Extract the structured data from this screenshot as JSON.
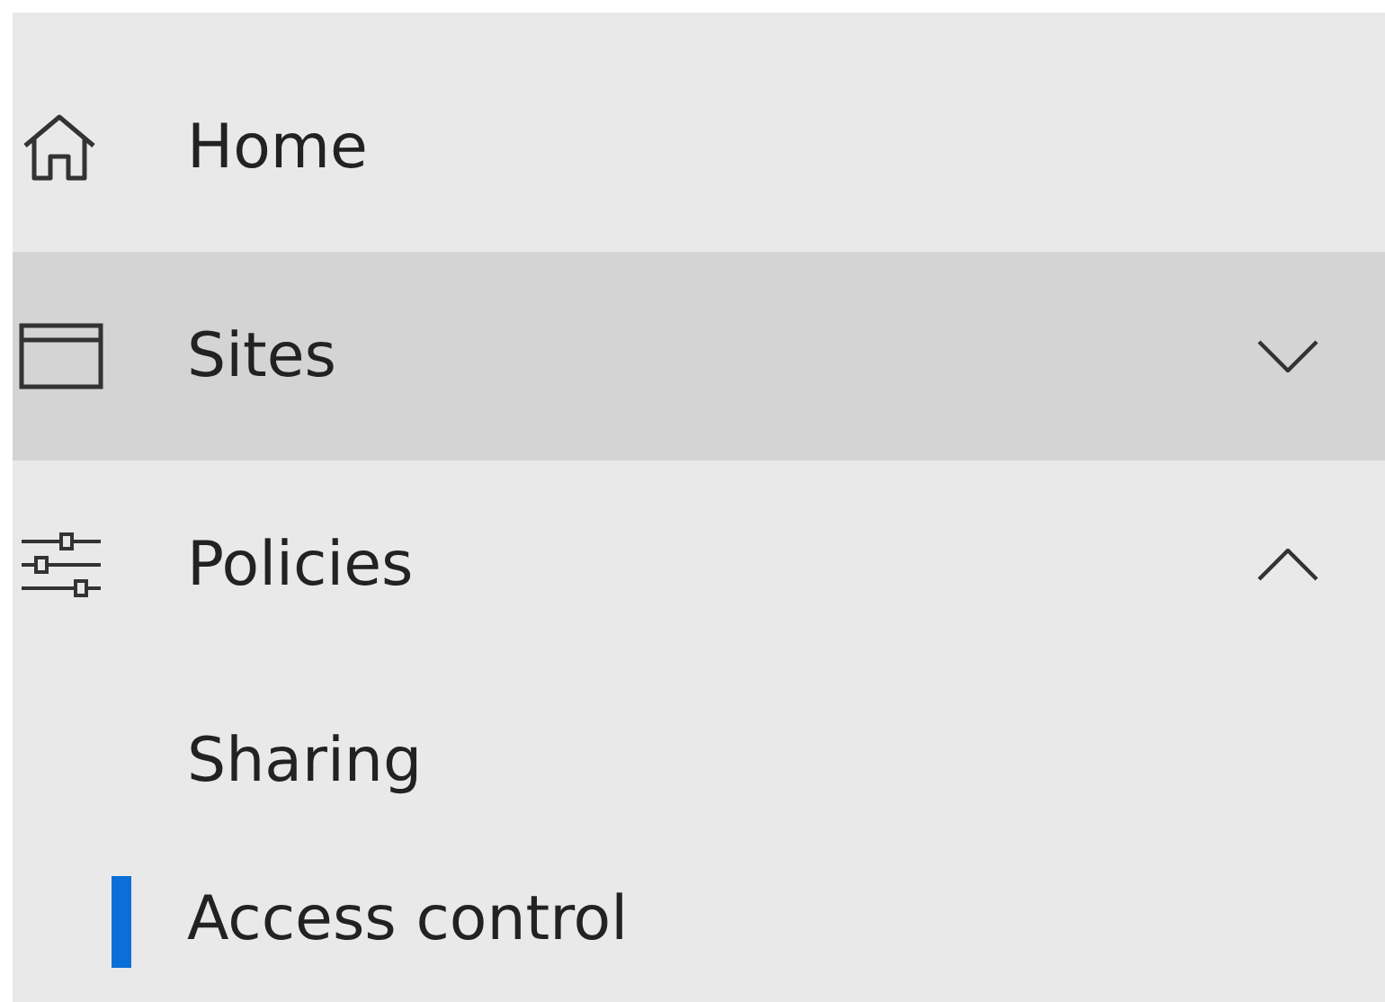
{
  "nav": {
    "items": [
      {
        "kind": "link",
        "label": "Home",
        "hovered": false
      },
      {
        "kind": "group",
        "label": "Sites",
        "hovered": true,
        "expanded": false
      },
      {
        "kind": "group",
        "label": "Policies",
        "hovered": false,
        "expanded": true,
        "children": [
          {
            "label": "Sharing",
            "selected": false
          },
          {
            "label": "Access control",
            "selected": true
          }
        ]
      }
    ]
  }
}
